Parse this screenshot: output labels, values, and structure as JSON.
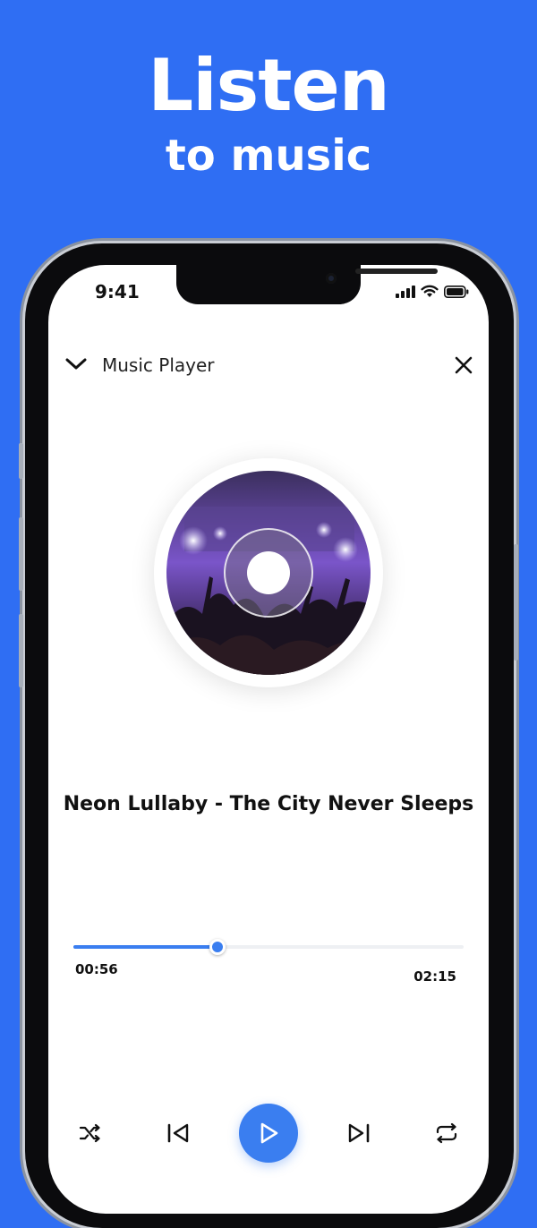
{
  "promo": {
    "title": "Listen",
    "subtitle": "to music"
  },
  "status_bar": {
    "time": "9:41",
    "icons": [
      "cellular-signal-icon",
      "wifi-icon",
      "battery-icon"
    ]
  },
  "appbar": {
    "back_icon": "chevron-down-icon",
    "title": "Music Player",
    "close_icon": "close-icon"
  },
  "track": {
    "title": "Neon Lullaby - The City Never Sleeps",
    "elapsed": "00:56",
    "total": "02:15",
    "progress_fraction": 0.37
  },
  "controls": {
    "shuffle_icon": "shuffle-icon",
    "previous_icon": "skip-previous-icon",
    "play_icon": "play-icon",
    "next_icon": "skip-next-icon",
    "repeat_icon": "repeat-icon"
  },
  "colors": {
    "background": "#2f6ef3",
    "accent": "#3a7ef0",
    "screen": "#ffffff",
    "text": "#111111"
  }
}
